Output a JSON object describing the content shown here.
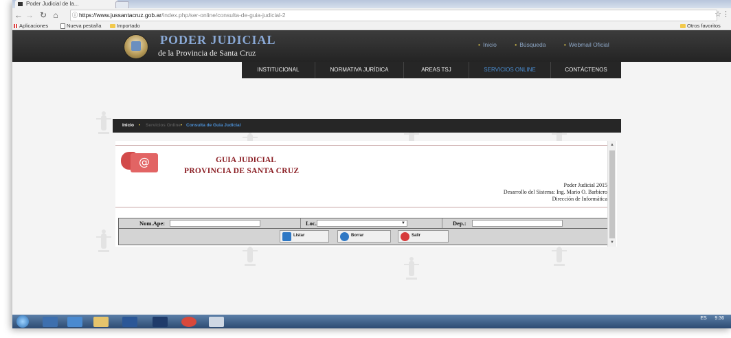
{
  "browser": {
    "tab_title": "Poder Judicial de la...",
    "url_host": "https://www.jussantacruz.gob.ar",
    "url_path": "/index.php/ser-online/consulta-de-guia-judicial-2",
    "bookmarks": [
      "Aplicaciones",
      "Nueva pestaña",
      "Importado"
    ],
    "other_bookmarks": "Otros favoritos"
  },
  "site": {
    "brand_title": "PODER JUDICIAL",
    "brand_subtitle": "de la Provincia de Santa Cruz",
    "top_links": [
      "Inicio",
      "Búsqueda",
      "Webmail Oficial"
    ],
    "nav": [
      "INSTITUCIONAL",
      "NORMATIVA JURÍDICA",
      "AREAS TSJ",
      "SERVICIOS ONLINE",
      "CONTÁCTENOS"
    ],
    "nav_active": "SERVICIOS ONLINE",
    "breadcrumb": [
      "Inicio",
      "Servicios Online",
      "Consulta de Guia Judicial"
    ]
  },
  "guia": {
    "title_line1": "GUIA JUDICIAL",
    "title_line2": "PROVINCIA DE SANTA CRUZ",
    "credits": [
      "Poder Judicial 2015",
      "Desarrollo del Sistema: Ing. Mario O. Barbiero",
      "Dirección de Informática"
    ],
    "form": {
      "name_label": "Nom.Ape:",
      "name_value": "",
      "loc_label": "Loc.:",
      "loc_selected": "",
      "dep_label": "Dep.:",
      "dep_value": "",
      "buttons": [
        "Listar",
        "Borrar",
        "Salir"
      ]
    }
  },
  "taskbar": {
    "clock": "9:36",
    "lang": "ES"
  },
  "colors": {
    "header_bg": "#2c2c2c",
    "brand_blue": "#8aa9d6",
    "nav_active": "#4b90d6",
    "guia_red": "#8b1e24"
  }
}
